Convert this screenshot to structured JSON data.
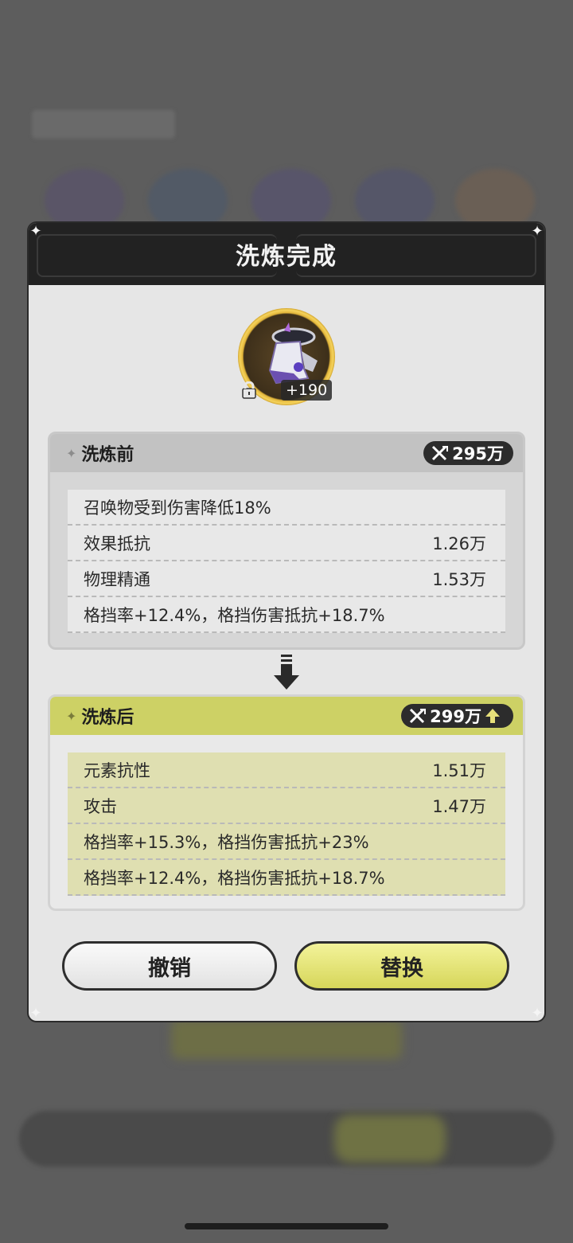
{
  "dialog": {
    "title": "洗炼完成",
    "item": {
      "level_badge": "+190"
    },
    "before": {
      "label": "洗炼前",
      "power": "295万",
      "stats": [
        {
          "name": "召唤物受到伤害降低18%",
          "value": ""
        },
        {
          "name": "效果抵抗",
          "value": "1.26万"
        },
        {
          "name": "物理精通",
          "value": "1.53万"
        },
        {
          "name": "格挡率+12.4%，格挡伤害抵抗+18.7%",
          "value": ""
        }
      ]
    },
    "after": {
      "label": "洗炼后",
      "power": "299万",
      "stats": [
        {
          "name": "元素抗性",
          "value": "1.51万"
        },
        {
          "name": "攻击",
          "value": "1.47万"
        },
        {
          "name": "格挡率+15.3%，格挡伤害抵抗+23%",
          "value": ""
        },
        {
          "name": "格挡率+12.4%，格挡伤害抵抗+18.7%",
          "value": ""
        }
      ]
    },
    "buttons": {
      "cancel": "撤销",
      "replace": "替换"
    }
  },
  "colors": {
    "accent_yellow": "#cdd165",
    "button_yellow": "#e5e57a",
    "header_dark": "#222222"
  }
}
